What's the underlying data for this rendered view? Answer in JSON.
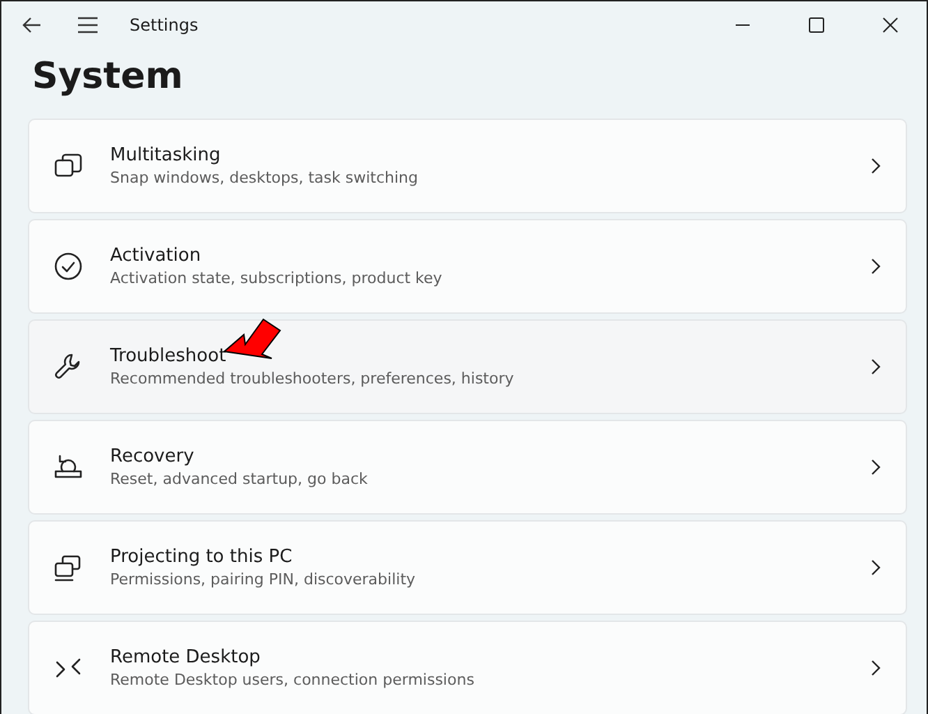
{
  "window": {
    "title": "Settings"
  },
  "page_title": "System",
  "items": [
    {
      "title": "Multitasking",
      "subtitle": "Snap windows, desktops, task switching",
      "hovered": false,
      "pointed": false
    },
    {
      "title": "Activation",
      "subtitle": "Activation state, subscriptions, product key",
      "hovered": false,
      "pointed": false
    },
    {
      "title": "Troubleshoot",
      "subtitle": "Recommended troubleshooters, preferences, history",
      "hovered": true,
      "pointed": true
    },
    {
      "title": "Recovery",
      "subtitle": "Reset, advanced startup, go back",
      "hovered": false,
      "pointed": false
    },
    {
      "title": "Projecting to this PC",
      "subtitle": "Permissions, pairing PIN, discoverability",
      "hovered": false,
      "pointed": false
    },
    {
      "title": "Remote Desktop",
      "subtitle": "Remote Desktop users, connection permissions",
      "hovered": false,
      "pointed": false
    }
  ]
}
